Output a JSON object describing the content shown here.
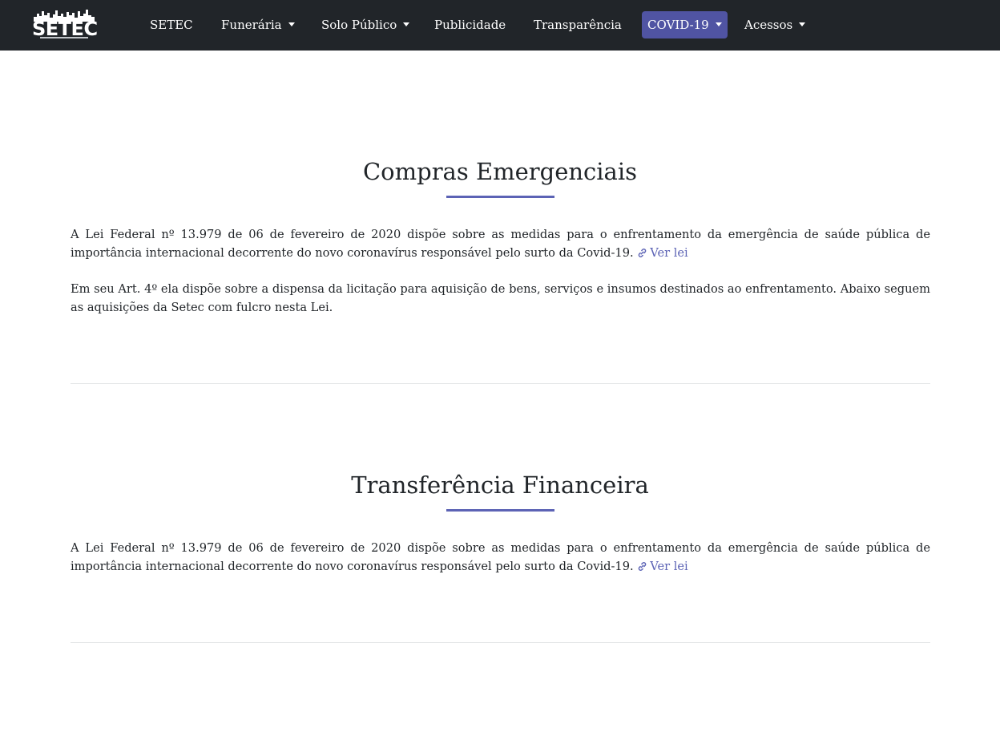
{
  "navbar": {
    "logo_text": "SETEC",
    "items": [
      {
        "label": "SETEC",
        "dropdown": false
      },
      {
        "label": "Funerária",
        "dropdown": true
      },
      {
        "label": "Solo Público",
        "dropdown": true
      },
      {
        "label": "Publicidade",
        "dropdown": false
      },
      {
        "label": "Transparência",
        "dropdown": false
      },
      {
        "label": "COVID-19",
        "dropdown": true,
        "active": true
      },
      {
        "label": "Acessos",
        "dropdown": true
      }
    ]
  },
  "sections": [
    {
      "title": "Compras Emergenciais",
      "paragraphs": [
        {
          "text": "A Lei Federal nº 13.979 de 06 de fevereiro de 2020 dispõe sobre as medidas para o enfrentamento da emergência de saúde pública de importância internacional decorrente do novo coronavírus responsável pelo surto da Covid-19.",
          "link_label": "Ver lei"
        },
        {
          "text": "Em seu Art. 4º ela dispõe sobre a dispensa da licitação para aquisição de bens, serviços e insumos destinados ao enfrentamento. Abaixo seguem as aquisições da Setec com fulcro nesta Lei."
        }
      ]
    },
    {
      "title": "Transferência Financeira",
      "paragraphs": [
        {
          "text": "A Lei Federal nº 13.979 de 06 de fevereiro de 2020 dispõe sobre as medidas para o enfrentamento da emergência de saúde pública de importância internacional decorrente do novo coronavírus responsável pelo surto da Covid-19.",
          "link_label": "Ver lei"
        }
      ]
    }
  ],
  "colors": {
    "navbar_bg": "#212529",
    "active_item_bg": "#5054a3",
    "accent": "#5c63b5",
    "text": "#212529",
    "divider": "#e2e4e6"
  },
  "icons": {
    "link": "link-icon",
    "dropdown": "caret-down-icon"
  }
}
